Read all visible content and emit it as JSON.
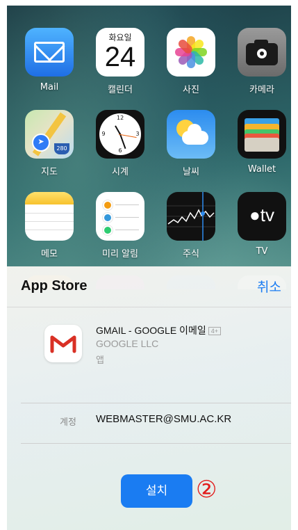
{
  "home_screen": {
    "apps": [
      {
        "label": "Mail",
        "icon": "mail-icon"
      },
      {
        "label": "캘린더",
        "icon": "calendar-icon",
        "day": "화요일",
        "date": "24"
      },
      {
        "label": "사진",
        "icon": "photos-icon"
      },
      {
        "label": "카메라",
        "icon": "camera-icon"
      },
      {
        "label": "지도",
        "icon": "maps-icon",
        "shield": "280"
      },
      {
        "label": "시계",
        "icon": "clock-icon"
      },
      {
        "label": "날씨",
        "icon": "weather-icon"
      },
      {
        "label": "Wallet",
        "icon": "wallet-icon"
      },
      {
        "label": "메모",
        "icon": "notes-icon"
      },
      {
        "label": "미리 알림",
        "icon": "reminders-icon"
      },
      {
        "label": "주식",
        "icon": "stocks-icon"
      },
      {
        "label": "TV",
        "icon": "tv-icon",
        "glyph": "tv"
      }
    ]
  },
  "sheet": {
    "title": "App Store",
    "cancel_label": "취소",
    "app_name": "GMAIL - GOOGLE 이메일",
    "age_rating": "4+",
    "developer": "GOOGLE LLC",
    "kind": "앱",
    "account_label": "계정",
    "account_value": "WEBMASTER@SMU.AC.KR",
    "install_label": "설치",
    "step_marker": "②"
  },
  "colors": {
    "accent": "#1a7cf2",
    "marker": "#e21b1b",
    "gmail_red": "#d93025"
  }
}
